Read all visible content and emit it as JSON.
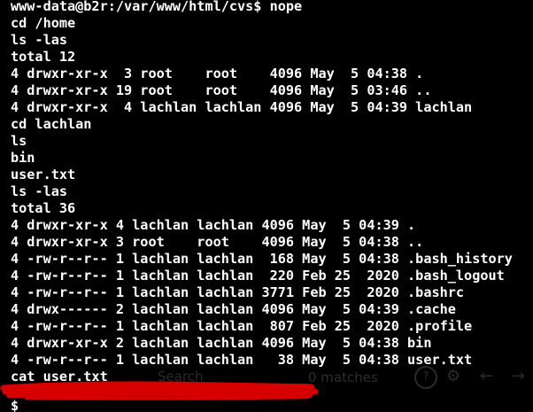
{
  "terminal": {
    "lines": [
      "www-data@b2r:/var/www/html/cvs$ nope",
      "cd /home",
      "ls -las",
      "total 12",
      "4 drwxr-xr-x  3 root    root    4096 May  5 04:38 .",
      "4 drwxr-xr-x 19 root    root    4096 May  5 03:46 ..",
      "4 drwxr-xr-x  4 lachlan lachlan 4096 May  5 04:39 lachlan",
      "cd lachlan",
      "ls",
      "bin",
      "user.txt",
      "ls -las",
      "total 36",
      "4 drwxr-xr-x 4 lachlan lachlan 4096 May  5 04:39 .",
      "4 drwxr-xr-x 3 root    root    4096 May  5 04:38 ..",
      "4 -rw-r--r-- 1 lachlan lachlan  168 May  5 04:38 .bash_history",
      "4 -rw-r--r-- 1 lachlan lachlan  220 Feb 25  2020 .bash_logout",
      "4 -rw-r--r-- 1 lachlan lachlan 3771 Feb 25  2020 .bashrc",
      "4 drwx------ 2 lachlan lachlan 4096 May  5 04:39 .cache",
      "4 -rw-r--r-- 1 lachlan lachlan  807 Feb 25  2020 .profile",
      "4 drwxr-xr-x 2 lachlan lachlan 4096 May  5 04:38 bin",
      "4 -rw-r--r-- 1 lachlan lachlan   38 May  5 04:38 user.txt",
      "cat user.txt"
    ],
    "prompt_partial": "$",
    "search": {
      "placeholder": "Search",
      "match_count": "0 matches"
    },
    "colors": {
      "background": "#000000",
      "text": "#ffffff",
      "redaction": "#d60000"
    },
    "icons": [
      "help-icon",
      "gear-icon",
      "arrow-left-icon",
      "arrow-right-icon"
    ]
  }
}
